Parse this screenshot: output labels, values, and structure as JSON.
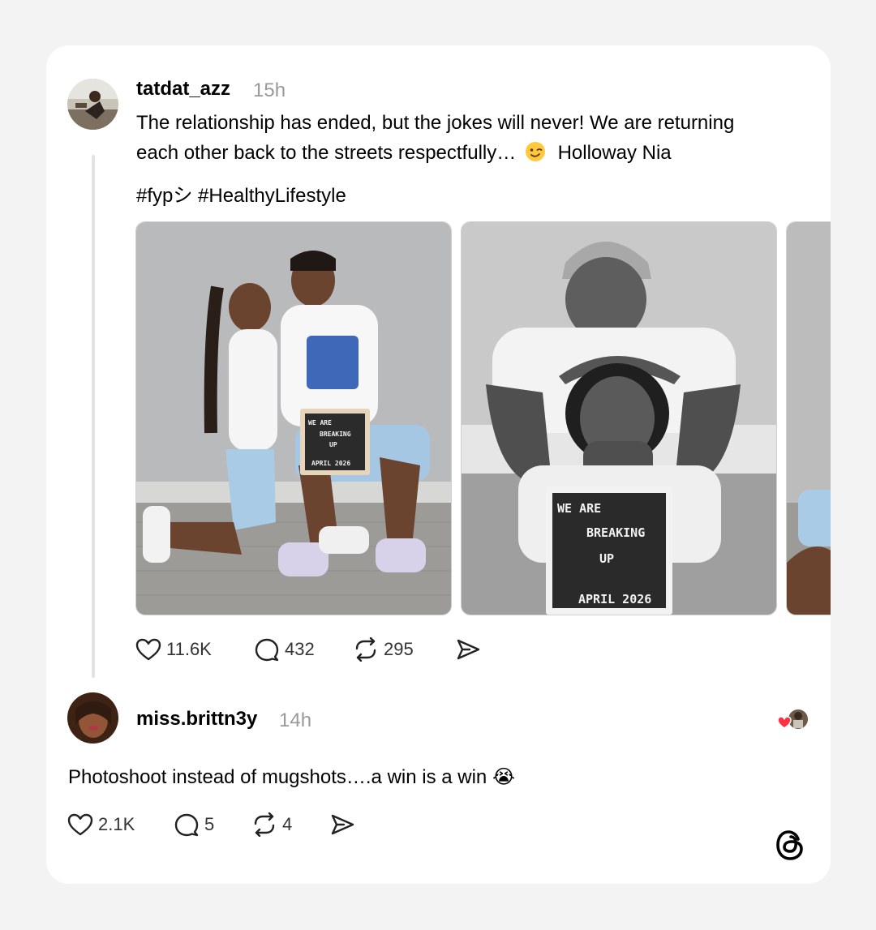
{
  "post": {
    "username": "tatdat_azz",
    "time": "15h",
    "text_line1": "The relationship has ended, but the jokes will never! We are returning",
    "text_line2": "each other back to the streets respectfully…",
    "mention": "Holloway Nia",
    "hashtags": "#fypシ #HealthyLifestyle",
    "sign_line1": "WE ARE",
    "sign_line2": "BREAKING",
    "sign_line3": "UP",
    "sign_line4": "APRIL 2026",
    "likes": "11.6K",
    "replies": "432",
    "reposts": "295"
  },
  "reply": {
    "username": "miss.brittn3y",
    "time": "14h",
    "text": "Photoshoot instead of mugshots….a win is a win",
    "emoji": "😭",
    "likes": "2.1K",
    "replies": "5",
    "reposts": "4"
  },
  "icons": [
    "heart-icon",
    "comment-icon",
    "repost-icon",
    "share-icon",
    "threads-logo-icon",
    "wink-emoji"
  ],
  "colors": {
    "background": "#f3f3f3",
    "card": "#ffffff",
    "muted": "#999999",
    "heart": "#ff3040"
  }
}
